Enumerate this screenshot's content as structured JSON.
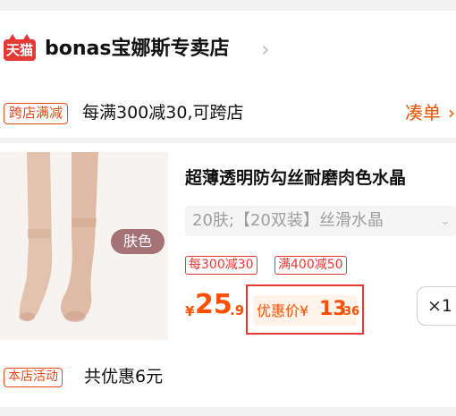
{
  "store": {
    "logo_text": "天猫",
    "name": "bonas宝娜斯专卖店",
    "chevron": "›"
  },
  "store_promo": {
    "tag": "跨店满减",
    "text": "每满300减30,可跨店",
    "action": "凑单",
    "action_chevron": "›"
  },
  "product": {
    "color_tag": "肤色",
    "title": "超薄透明防勾丝耐磨肉色水晶",
    "sku": "20肤;【20双装】丝滑水晶",
    "sku_chevron": "⌄",
    "discounts": [
      "每300减30",
      "满400减50"
    ],
    "price": {
      "symbol": "¥",
      "integer": "25",
      "decimal": ".9"
    },
    "coupon_price": {
      "label": "优惠价¥",
      "integer": "13",
      "decimal": ".36"
    },
    "quantity": "×1"
  },
  "shop_activity": {
    "tag": "本店活动",
    "text": "共优惠6元"
  },
  "colors": {
    "accent": "#ff4f00",
    "tag_red": "#e64a19",
    "tmall_red": "#e53935"
  }
}
